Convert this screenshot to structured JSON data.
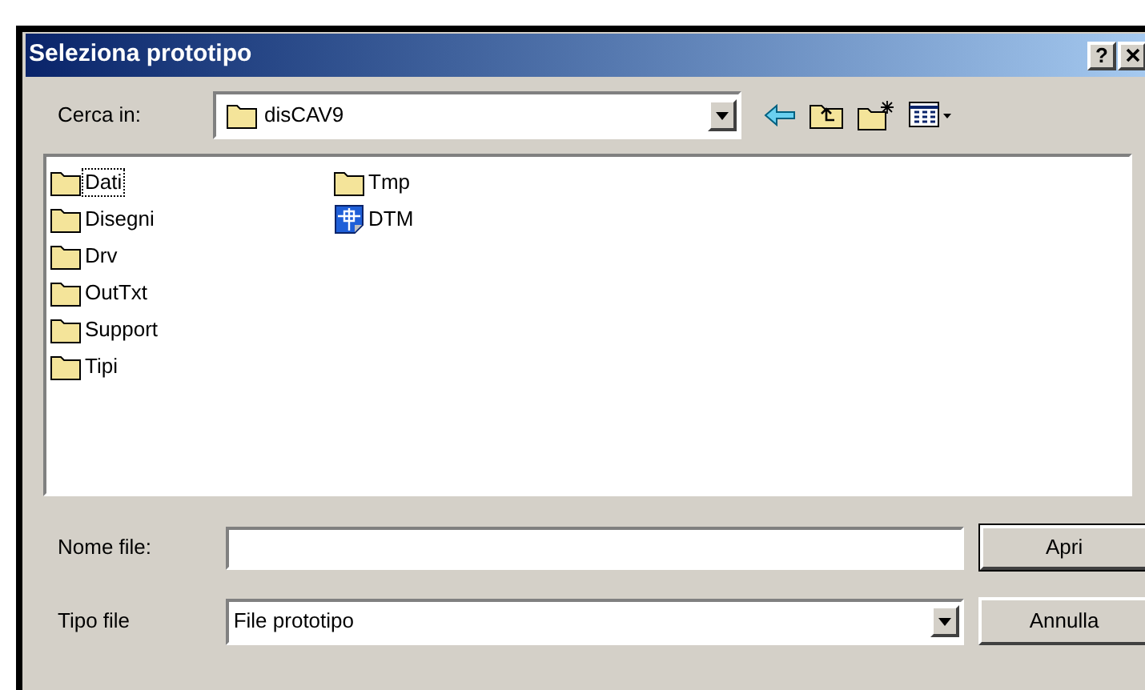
{
  "window": {
    "title": "Seleziona prototipo",
    "help": "?"
  },
  "look_in": {
    "label": "Cerca in:",
    "value": "disCAV9"
  },
  "files": [
    {
      "name": "Dati",
      "kind": "folder",
      "selected": true
    },
    {
      "name": "Disegni",
      "kind": "folder",
      "selected": false
    },
    {
      "name": "Drv",
      "kind": "folder",
      "selected": false
    },
    {
      "name": "OutTxt",
      "kind": "folder",
      "selected": false
    },
    {
      "name": "Support",
      "kind": "folder",
      "selected": false
    },
    {
      "name": "Tipi",
      "kind": "folder",
      "selected": false
    },
    {
      "name": "Tmp",
      "kind": "folder",
      "selected": false
    },
    {
      "name": "DTM",
      "kind": "drawing",
      "selected": false
    }
  ],
  "file_name": {
    "label": "Nome file:"
  },
  "file_type": {
    "label": "Tipo file",
    "value": "File prototipo"
  },
  "buttons": [
    "Apri",
    "Annulla"
  ]
}
